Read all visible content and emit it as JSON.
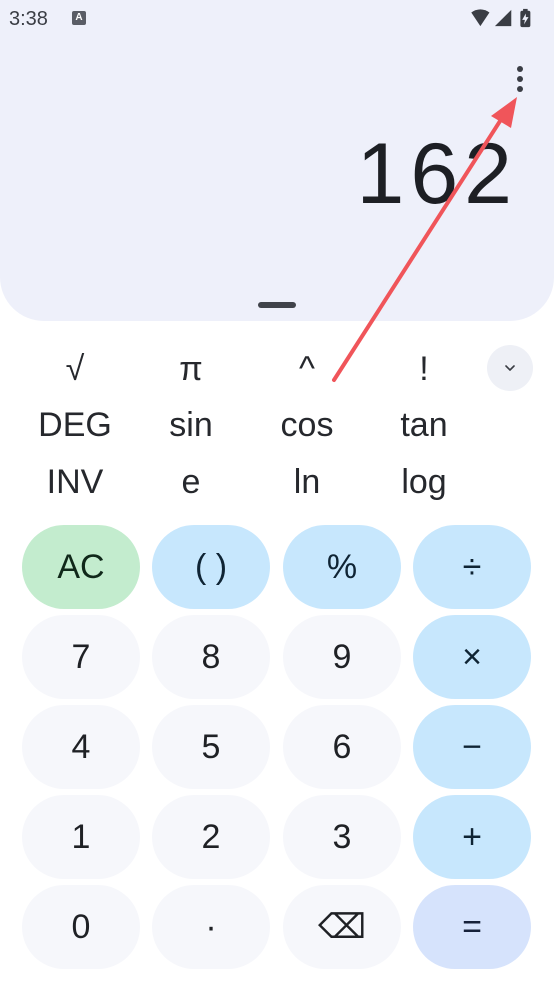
{
  "status_bar": {
    "time": "3:38",
    "notification_icon": "a-icon",
    "icons": [
      "wifi-icon",
      "signal-icon",
      "battery-icon"
    ]
  },
  "display": {
    "result": "162",
    "menu_icon": "more-vert-icon"
  },
  "scientific_keys": [
    [
      "√",
      "π",
      "^",
      "!"
    ],
    [
      "DEG",
      "sin",
      "cos",
      "tan"
    ],
    [
      "INV",
      "e",
      "ln",
      "log"
    ]
  ],
  "collapse_icon": "chevron-down-icon",
  "keypad": [
    [
      "AC",
      "( )",
      "%",
      "÷"
    ],
    [
      "7",
      "8",
      "9",
      "×"
    ],
    [
      "4",
      "5",
      "6",
      "−"
    ],
    [
      "1",
      "2",
      "3",
      "+"
    ],
    [
      "0",
      "·",
      "⌫",
      "="
    ]
  ],
  "colors": {
    "display_bg": "#eef0fa",
    "clear_key": "#c3ecce",
    "operator_key": "#c7e7fd",
    "equals_key": "#d6e3fc",
    "digit_key": "#f6f7fb",
    "annotation_arrow": "#f0555a"
  }
}
